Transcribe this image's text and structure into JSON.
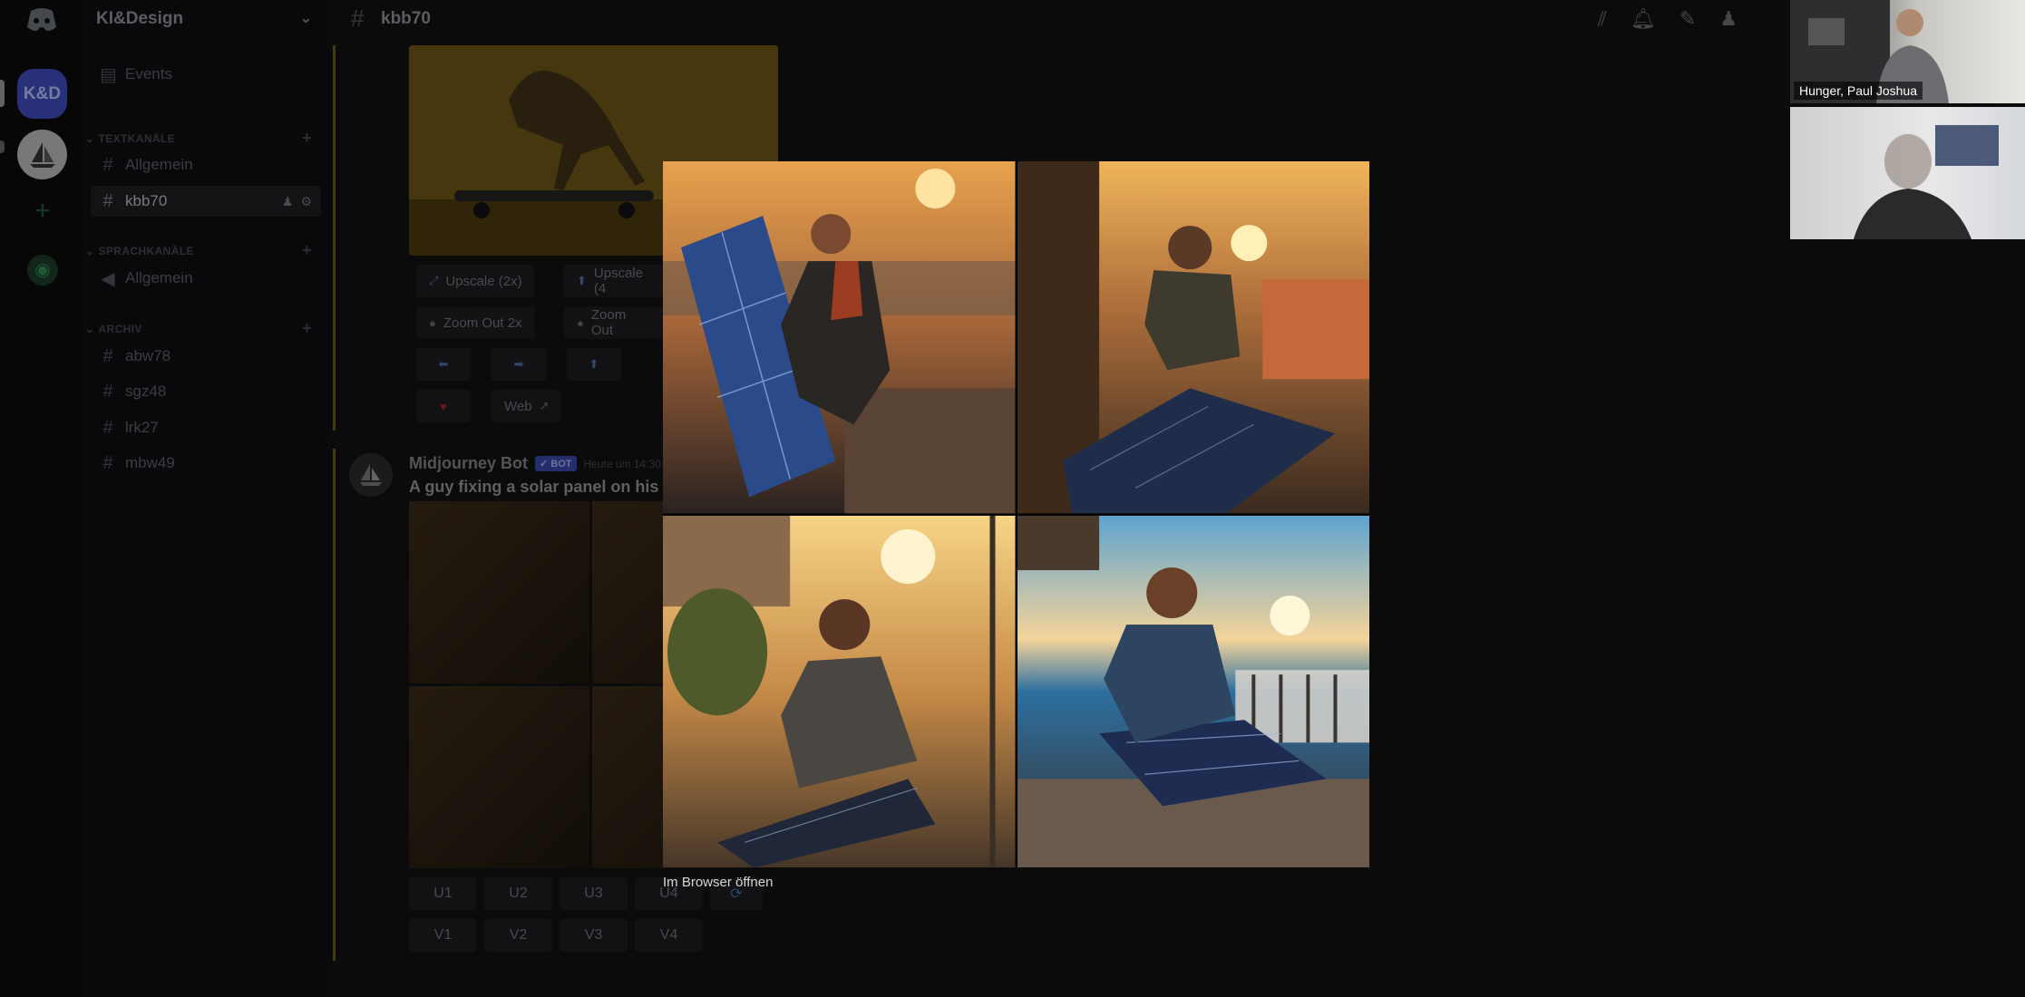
{
  "server": {
    "home_icon": "discord-logo-icon",
    "abbrev": "K&D",
    "name": "KI&Design"
  },
  "sidebar": {
    "events_label": "Events",
    "categories": {
      "text": "TEXTKANÄLE",
      "voice": "SPRACHKANÄLE",
      "archive": "ARCHIV"
    },
    "text_channels": [
      "Allgemein",
      "kbb70"
    ],
    "voice_channels": [
      "Allgemein"
    ],
    "archive_channels": [
      "abw78",
      "sgz48",
      "lrk27",
      "mbw49"
    ]
  },
  "topbar": {
    "channel": "kbb70"
  },
  "message1": {
    "buttons": {
      "upscale2x": "Upscale (2x)",
      "upscale4x": "Upscale (4",
      "zoomout2x": "Zoom Out 2x",
      "zoomout": "Zoom Out",
      "web": "Web"
    }
  },
  "message2": {
    "author": "Midjourney Bot",
    "badge": "BOT",
    "timestamp": "Heute um 14:30",
    "prompt": "A guy fixing a solar panel on his ba",
    "u_buttons": [
      "U1",
      "U2",
      "U3",
      "U4"
    ],
    "v_buttons": [
      "V1",
      "V2",
      "V3",
      "V4"
    ]
  },
  "lightbox": {
    "open_in_browser": "Im Browser öffnen"
  },
  "video": {
    "participant1": "Hunger, Paul Joshua"
  },
  "colors": {
    "accent": "#3c4ab8",
    "sunset": "#f2b24a"
  }
}
